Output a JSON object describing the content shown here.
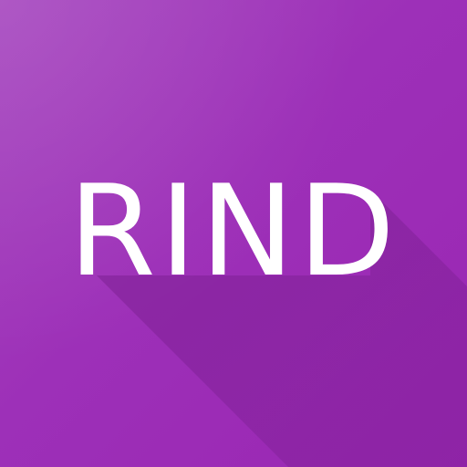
{
  "icon": {
    "label": "RIND",
    "colors": {
      "background": "#9d30b8",
      "background_light": "#a545be",
      "long_shadow": "#7a1e90",
      "text": "#ffffff"
    }
  }
}
